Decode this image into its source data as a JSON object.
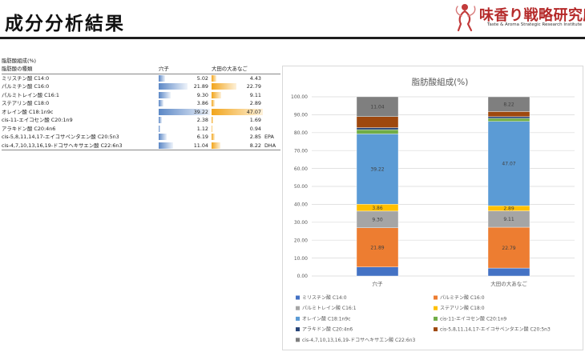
{
  "page": {
    "title": "成分分析結果",
    "logo_name": "味香り戦略研究所",
    "logo_sub": "Taste & Aroma Strategic Research Institute"
  },
  "table": {
    "caption": "脂肪酸組成(%)",
    "col_name": "脂肪酸の種類",
    "col_a": "穴子",
    "col_b": "大田の大あなご",
    "rows": [
      {
        "name": "ミリスチン酸 C14:0",
        "a": "5.02",
        "b": "4.43",
        "note": ""
      },
      {
        "name": "パルミチン酸 C16:0",
        "a": "21.89",
        "b": "22.79",
        "note": ""
      },
      {
        "name": "パルミトレイン酸 C16:1",
        "a": "9.30",
        "b": "9.11",
        "note": ""
      },
      {
        "name": "ステアリン酸 C18:0",
        "a": "3.86",
        "b": "2.89",
        "note": ""
      },
      {
        "name": "オレイン酸 C18:1n9c",
        "a": "39.22",
        "b": "47.07",
        "note": ""
      },
      {
        "name": "cis-11-エイコセン酸 C20:1n9",
        "a": "2.38",
        "b": "1.69",
        "note": ""
      },
      {
        "name": "アラキドン酸 C20:4n6",
        "a": "1.12",
        "b": "0.94",
        "note": ""
      },
      {
        "name": "cis-5,8,11,14,17-エイコサペンタエン酸 C20:5n3",
        "a": "6.19",
        "b": "2.85",
        "note": "EPA"
      },
      {
        "name": "cis-4,7,10,13,16,19-ドコサヘキサエン酸 C22:6n3",
        "a": "11.04",
        "b": "8.22",
        "note": "DHA"
      }
    ]
  },
  "chart_data": {
    "type": "bar",
    "stacked": true,
    "title": "脂肪酸組成(%)",
    "categories": [
      "穴子",
      "大田の大あなご"
    ],
    "ylim": [
      0,
      100
    ],
    "yticks": [
      "0.00",
      "10.00",
      "20.00",
      "30.00",
      "40.00",
      "50.00",
      "60.00",
      "70.00",
      "80.00",
      "90.00",
      "100.00"
    ],
    "grid": true,
    "legend_position": "bottom",
    "series": [
      {
        "name": "ミリスチン酸 C14:0",
        "values": [
          5.02,
          4.43
        ],
        "color": "#4472c4"
      },
      {
        "name": "パルミチン酸 C16:0",
        "values": [
          21.89,
          22.79
        ],
        "color": "#ed7d31"
      },
      {
        "name": "パルミトレイン酸 C16:1",
        "values": [
          9.3,
          9.11
        ],
        "color": "#a5a5a5"
      },
      {
        "name": "ステアリン酸 C18:0",
        "values": [
          3.86,
          2.89
        ],
        "color": "#ffc000"
      },
      {
        "name": "オレイン酸 C18:1n9c",
        "values": [
          39.22,
          47.07
        ],
        "color": "#5b9bd5"
      },
      {
        "name": "cis-11-エイコセン酸 C20:1n9",
        "values": [
          2.38,
          1.69
        ],
        "color": "#70ad47"
      },
      {
        "name": "アラキドン酸 C20:4n6",
        "values": [
          1.12,
          0.94
        ],
        "color": "#264478"
      },
      {
        "name": "cis-5,8,11,14,17-エイコサペンタエン酸 C20:5n3",
        "values": [
          6.19,
          2.85
        ],
        "color": "#9e480e"
      },
      {
        "name": "cis-4,7,10,13,16,19-ドコサヘキサエン酸 C22:6n3",
        "values": [
          11.04,
          8.22
        ],
        "color": "#7f7f7f"
      }
    ],
    "data_labels": [
      [
        "",
        "21.89",
        "9.30",
        "3.86",
        "39.22",
        "",
        "",
        "",
        "11.04"
      ],
      [
        "",
        "22.79",
        "9.11",
        "2.89",
        "47.07",
        "",
        "",
        "",
        "8.22"
      ]
    ]
  }
}
